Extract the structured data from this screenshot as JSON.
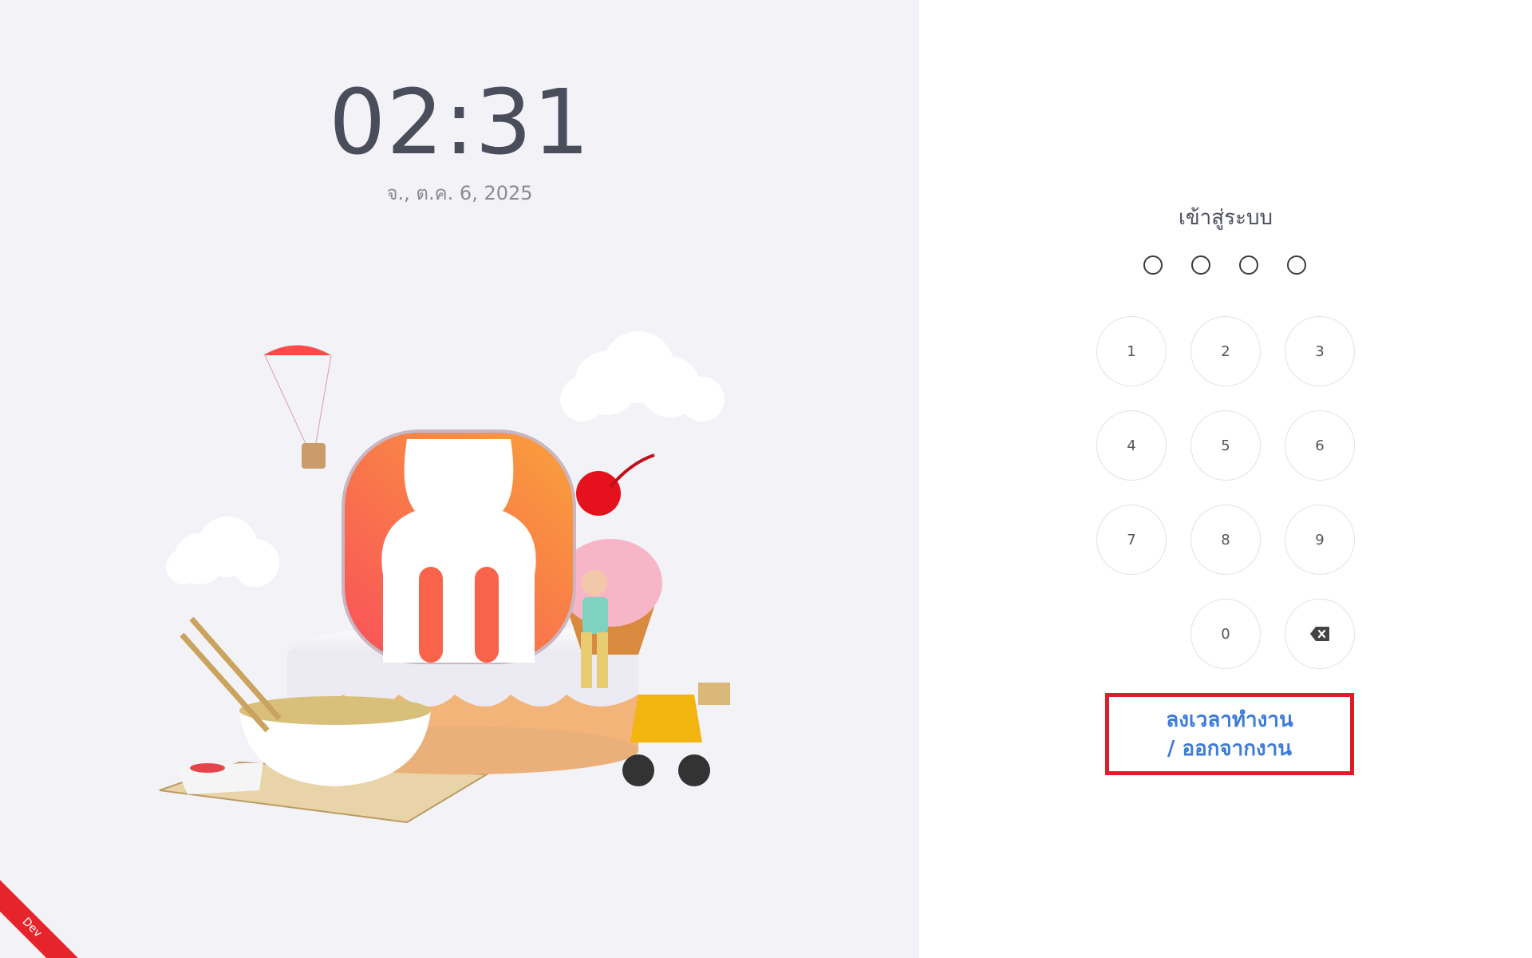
{
  "clock": {
    "time": "02:31",
    "date": "จ., ต.ค. 6, 2025"
  },
  "env_badge": "Dev",
  "login": {
    "title": "เข้าสู่ระบบ",
    "pin_length": 4,
    "keys": [
      "1",
      "2",
      "3",
      "4",
      "5",
      "6",
      "7",
      "8",
      "9",
      "0"
    ],
    "backspace_icon": "backspace-icon",
    "clock_in_line1": "ลงเวลาทำงาน",
    "clock_in_line2": "/ ออกจากงาน"
  },
  "colors": {
    "left_bg": "#f3f2f7",
    "accent_blue": "#3d7bd8",
    "highlight_red": "#e11c2a",
    "logo_orange": "#f6763c"
  }
}
